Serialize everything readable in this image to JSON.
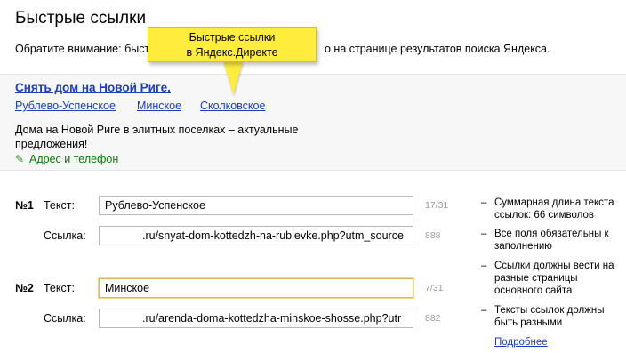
{
  "page": {
    "title": "Быстрые ссылки"
  },
  "notice": {
    "left": "Обратите внимание: быст",
    "right": "о на странице результатов поиска Яндекса."
  },
  "callout": {
    "line1": "Быстрые ссылки",
    "line2": "в Яндекс.Директе"
  },
  "preview": {
    "ad_title": "Снять дом на Новой Риге.",
    "sitelinks": [
      "Рублево-Успенское",
      "Минское",
      "Сколковское"
    ],
    "description": "Дома на Новой Риге в элитных поселках – актуальные предложения!",
    "contact_label": "Адрес и телефон",
    "contact_icon": "pencil-icon"
  },
  "form": {
    "text_label": "Текст:",
    "link_label": "Ссылка:",
    "rows": [
      {
        "number": "№1",
        "text_value": "Рублево-Успенское",
        "text_count": "17/31",
        "link_value": ".ru/snyat-dom-kottedzh-na-rublevke.php?utm_source",
        "link_count": "888"
      },
      {
        "number": "№2",
        "text_value": "Минское",
        "text_count": "7/31",
        "link_value": ".ru/arenda-doma-kottedzha-minskoe-shosse.php?utr",
        "link_count": "882"
      }
    ]
  },
  "hints": {
    "dash": "–",
    "items": [
      "Суммарная длина текста ссылок: 66 символов",
      "Все поля обязательны к заполнению",
      "Ссылки должны вести на разные страницы основного сайта",
      "Тексты ссылок должны быть разными"
    ],
    "more_link": "Подробнее"
  },
  "colors": {
    "link": "#1a3dc1",
    "contact": "#0a7a0a",
    "callout": "#ffec3d",
    "focus_border": "#e0b64a"
  }
}
